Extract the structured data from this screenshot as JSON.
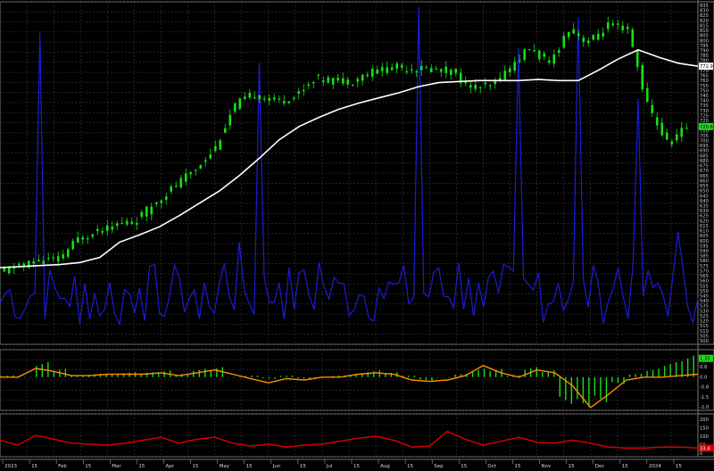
{
  "chart_data": [
    {
      "type": "candlestick",
      "panel": "price",
      "y_ticks": [
        "835",
        "830",
        "825",
        "820",
        "815",
        "810",
        "805",
        "800",
        "795",
        "790",
        "785",
        "780",
        "775",
        "770",
        "765",
        "760",
        "755",
        "750",
        "745",
        "740",
        "735",
        "730",
        "725",
        "720",
        "715",
        "710",
        "705",
        "700",
        "695",
        "690",
        "685",
        "680",
        "675",
        "670",
        "665",
        "660",
        "655",
        "650",
        "645",
        "640",
        "635",
        "630",
        "625",
        "620",
        "615",
        "610",
        "605",
        "600",
        "595",
        "590",
        "585",
        "580",
        "575",
        "570",
        "565",
        "560",
        "555",
        "550",
        "545",
        "540",
        "535",
        "530",
        "525",
        "520",
        "515",
        "510",
        "505",
        "500"
      ],
      "ylim": [
        500,
        835
      ],
      "candle_color": "#16e016",
      "moving_average": {
        "color": "#ffffff",
        "values": [
          575,
          576,
          577,
          578,
          580,
          585,
          600,
          607,
          615,
          626,
          638,
          650,
          665,
          682,
          700,
          713,
          722,
          730,
          736,
          741,
          746,
          752,
          756,
          757,
          758,
          758,
          758,
          759,
          758,
          758,
          768,
          779,
          788,
          781,
          775,
          772
        ],
        "last_label": "772.9"
      },
      "close": {
        "values": [
          570,
          577,
          582,
          583,
          603,
          611,
          617,
          622,
          640,
          656,
          672,
          693,
          734,
          745,
          738,
          742,
          760,
          758,
          758,
          767,
          771,
          770,
          769,
          767,
          751,
          752,
          771,
          790,
          774,
          809,
          795,
          812,
          808,
          734,
          697,
          713
        ],
        "last_label": "720.6"
      },
      "volume": {
        "color": "#1c1cd6",
        "values": [
          540,
          525,
          805,
          545,
          520,
          528,
          520,
          555,
          530,
          565,
          525,
          560,
          600,
          775,
          560,
          570,
          580,
          560,
          548,
          555,
          560,
          830,
          575,
          580,
          560,
          550,
          790,
          570,
          560,
          820,
          560,
          575,
          740,
          560,
          610,
          545
        ]
      }
    },
    {
      "type": "bar",
      "panel": "macd",
      "y_ticks": [
        "1.5",
        "0.8",
        "0.0",
        "-0.8",
        "-1.5",
        "-2.0"
      ],
      "ylim": [
        -2.3,
        1.9
      ],
      "bar_positive_color": "#16e016",
      "bar_negative_color": "#16e016",
      "signal_color": "#ff8c00",
      "histogram": [
        0.1,
        0.0,
        0.9,
        0.5,
        0.1,
        0.2,
        0.2,
        0.3,
        0.3,
        0.4,
        0.2,
        0.5,
        0.6,
        0.0,
        0.1,
        -0.1,
        0.1,
        -0.1,
        0.0,
        0.1,
        0.2,
        0.4,
        0.3,
        0.1,
        -0.2,
        0.0,
        0.2,
        0.5,
        0.5,
        0.1,
        0.6,
        0.4,
        -1.6,
        -1.8,
        -1.5,
        -0.4,
        0.2,
        0.5,
        0.9,
        1.3
      ],
      "signal": [
        0.0,
        0.0,
        0.6,
        0.4,
        0.1,
        0.1,
        0.2,
        0.2,
        0.2,
        0.3,
        0.1,
        0.3,
        0.5,
        0.2,
        -0.1,
        -0.4,
        -0.1,
        -0.2,
        0.0,
        0.0,
        0.2,
        0.3,
        0.2,
        -0.2,
        -0.3,
        -0.2,
        0.1,
        0.8,
        0.3,
        0.0,
        0.5,
        0.3,
        -0.6,
        -2.1,
        -1.2,
        -0.2,
        0.0,
        0.0,
        0.1,
        0.2
      ],
      "last_label": "1.33"
    },
    {
      "type": "line",
      "panel": "oscillator",
      "y_ticks": [
        "200",
        "150",
        "100",
        "50",
        "0"
      ],
      "ylim": [
        0,
        200
      ],
      "color": "#d10000",
      "values": [
        75,
        50,
        100,
        80,
        60,
        55,
        50,
        60,
        75,
        90,
        60,
        80,
        90,
        60,
        45,
        55,
        40,
        50,
        55,
        70,
        85,
        95,
        75,
        40,
        45,
        120,
        80,
        50,
        70,
        90,
        65,
        60,
        75,
        60,
        40,
        35,
        35,
        40,
        40,
        35
      ],
      "last_label": "33.4"
    }
  ],
  "x_axis": {
    "labels": [
      "2023",
      "15",
      "Feb",
      "15",
      "Mar",
      "15",
      "Apr",
      "15",
      "May",
      "15",
      "Jun",
      "15",
      "Jul",
      "15",
      "Aug",
      "15",
      "Sep",
      "15",
      "Oct",
      "15",
      "Nov",
      "15",
      "Dec",
      "15",
      "2024",
      "15"
    ]
  }
}
